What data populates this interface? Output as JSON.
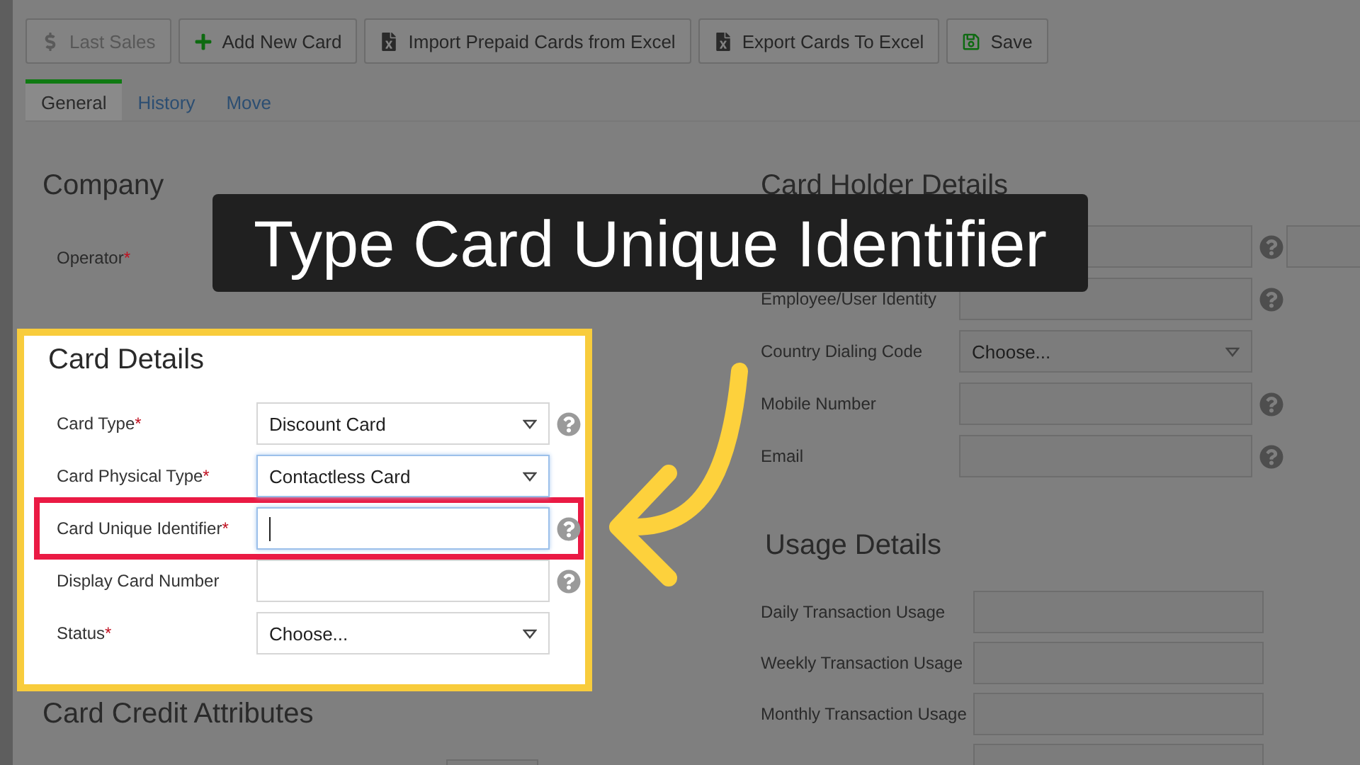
{
  "toolbar": [
    {
      "label": "Last Sales",
      "disabled": true
    },
    {
      "label": "Add New Card",
      "disabled": false
    },
    {
      "label": "Import Prepaid Cards from Excel",
      "disabled": false
    },
    {
      "label": "Export Cards To Excel",
      "disabled": false
    },
    {
      "label": "Save",
      "disabled": false
    }
  ],
  "tabs": [
    {
      "label": "General",
      "selected": true
    },
    {
      "label": "History",
      "selected": false
    },
    {
      "label": "Move",
      "selected": false
    }
  ],
  "callout": {
    "text": "Type Card Unique Identifier"
  },
  "company": {
    "title": "Company",
    "fields": [
      {
        "label": "Operator",
        "mark": "*"
      }
    ]
  },
  "card_details": {
    "title": "Card Details",
    "spotlight": true,
    "fields": [
      {
        "label": "Card Type",
        "mark": "*",
        "kind": "select",
        "value": "Discount Card",
        "help": true,
        "focused": false,
        "highlighted": false
      },
      {
        "label": "Card Physical Type",
        "mark": "*",
        "kind": "select",
        "value": "Contactless Card",
        "help": false,
        "focused": true,
        "highlighted": false
      },
      {
        "label": "Card Unique Identifier",
        "mark": "*",
        "kind": "input",
        "help": true,
        "focused": true,
        "highlighted": true
      },
      {
        "label": "Display Card Number",
        "kind": "input",
        "help": true,
        "focused": false,
        "highlighted": false
      },
      {
        "label": "Status",
        "mark": "*",
        "kind": "select",
        "value": "Choose...",
        "help": false,
        "focused": false,
        "highlighted": false
      }
    ]
  },
  "card_credit_attributes": {
    "title": "Card Credit Attributes"
  },
  "card_holder_details": {
    "title": "Card Holder Details",
    "fields": [
      {
        "kind": "input",
        "help": true,
        "extra": true
      },
      {
        "label": "Employee/User Identity",
        "kind": "input",
        "help": true,
        "extra": false
      },
      {
        "label": "Country Dialing Code",
        "kind": "select",
        "value": "Choose...",
        "help": false,
        "extra": false
      },
      {
        "label": "Mobile Number",
        "kind": "input",
        "help": true,
        "extra": false
      },
      {
        "label": "Email",
        "kind": "input",
        "help": true,
        "extra": false
      }
    ]
  },
  "usage_details": {
    "title": "Usage Details",
    "fields": [
      {
        "label": "Daily Transaction Usage",
        "kind": "input"
      },
      {
        "label": "Weekly Transaction Usage",
        "kind": "input"
      },
      {
        "label": "Monthly Transaction Usage",
        "kind": "input"
      },
      {
        "kind": "input"
      }
    ]
  }
}
